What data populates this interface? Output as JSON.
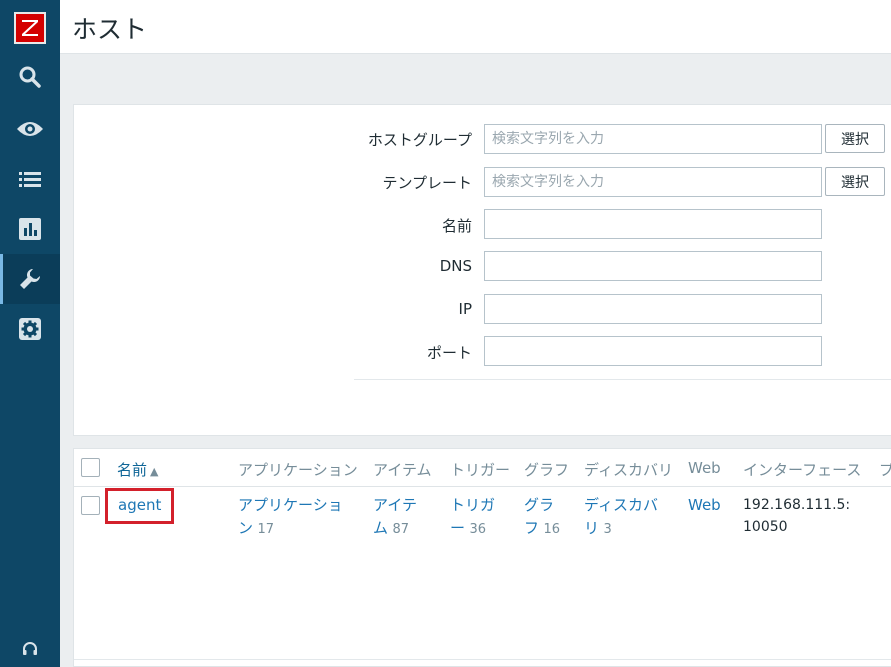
{
  "sidebar": {
    "logo_letter": "Z",
    "icons": [
      "search-icon",
      "eye-icon",
      "list-icon",
      "chart-icon",
      "wrench-icon",
      "gear-icon",
      "headset-icon"
    ],
    "active_item": "wrench-icon",
    "colors": {
      "background": "#0e4766",
      "logo": "#d40000"
    }
  },
  "header": {
    "title": "ホスト"
  },
  "filter": {
    "hostgroup_label": "ホストグループ",
    "hostgroup_placeholder": "検索文字列を入力",
    "template_label": "テンプレート",
    "template_placeholder": "検索文字列を入力",
    "select_label": "選択",
    "name_label": "名前",
    "dns_label": "DNS",
    "ip_label": "IP",
    "port_label": "ポート",
    "name_value": "",
    "dns_value": "",
    "ip_value": "",
    "port_value": ""
  },
  "table": {
    "columns": {
      "name": "名前",
      "sort_arrow": "▲",
      "applications": "アプリケーション",
      "items": "アイテム",
      "triggers": "トリガー",
      "graphs": "グラフ",
      "discovery": "ディスカバリ",
      "web": "Web",
      "interface": "インターフェース",
      "next": "プ"
    },
    "rows": [
      {
        "name": "agent",
        "applications": {
          "line1": "アプリケーショ",
          "line2": "ン",
          "count": "17"
        },
        "items": {
          "line1": "アイテ",
          "line2": "ム",
          "count": "87"
        },
        "triggers": {
          "line1": "トリガ",
          "line2": "ー",
          "count": "36"
        },
        "graphs": {
          "line1": "グラ",
          "line2": "フ",
          "count": "16"
        },
        "discovery": {
          "line1": "ディスカバ",
          "line2": "リ",
          "count": "3"
        },
        "web": "Web",
        "interface": {
          "line1": "192.168.111.5:",
          "line2": "10050"
        }
      }
    ]
  },
  "accent_colors": {
    "link": "#1e77b5",
    "highlight": "#d3202b"
  }
}
